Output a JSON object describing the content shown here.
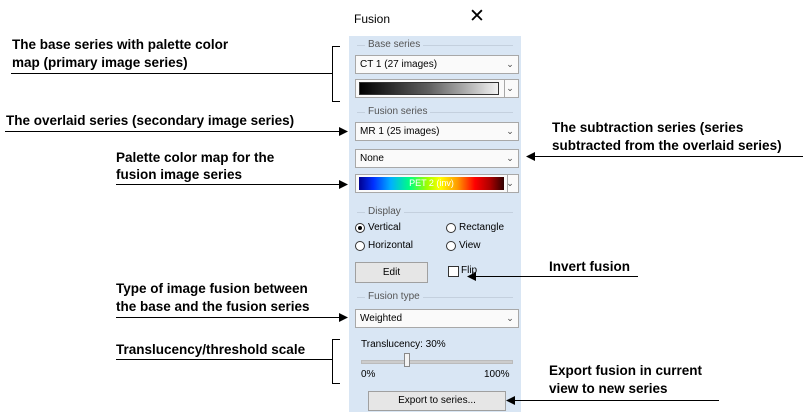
{
  "window": {
    "title": "Fusion",
    "close_glyph": "✕"
  },
  "base_series": {
    "group_label": "Base series",
    "series_value": "CT 1 (27 images)",
    "palette_value": "grayscale"
  },
  "fusion_series": {
    "group_label": "Fusion series",
    "series_value": "MR 1 (25 images)",
    "subtraction_value": "None",
    "palette_value": "PET 2 (inv)"
  },
  "display": {
    "group_label": "Display",
    "options": [
      {
        "label": "Vertical",
        "selected": true
      },
      {
        "label": "Rectangle",
        "selected": false
      },
      {
        "label": "Horizontal",
        "selected": false
      },
      {
        "label": "View",
        "selected": false
      }
    ],
    "edit_label": "Edit",
    "flip_label": "Flip",
    "flip_checked": false
  },
  "fusion_type": {
    "group_label": "Fusion type",
    "value": "Weighted"
  },
  "translucency": {
    "label": "Translucency: 30%",
    "value_percent": 30,
    "min_label": "0%",
    "max_label": "100%"
  },
  "export_label": "Export to series...",
  "annotations": {
    "base_line1": "The base series with palette color",
    "base_line2": "map (primary image series)",
    "overlaid": "The overlaid series (secondary image series)",
    "palette_line1": "Palette color map for the",
    "palette_line2": "fusion image series",
    "subtraction_line1": "The subtraction series (series",
    "subtraction_line2": "subtracted from the overlaid series)",
    "invert": "Invert fusion",
    "type_line1": "Type of image fusion between",
    "type_line2": "the base and the fusion series",
    "translucency": "Translucency/threshold scale",
    "export_line1": "Export fusion in current",
    "export_line2": "view to new series"
  },
  "icons": {
    "dropdown": "chevron-down-icon",
    "close": "close-icon"
  }
}
